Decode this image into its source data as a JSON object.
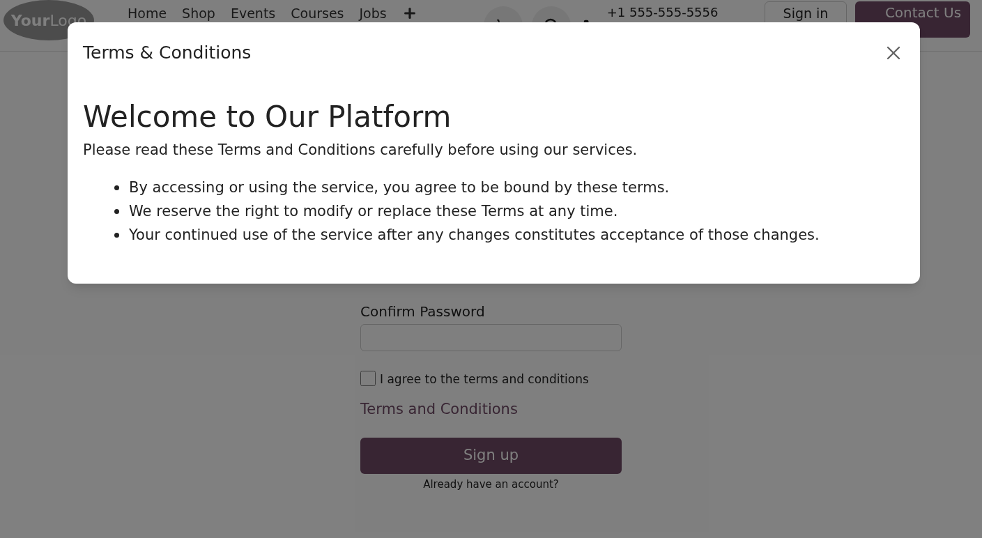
{
  "header": {
    "logo": "**Your**Logo",
    "nav": [
      {
        "label": "Home"
      },
      {
        "label": "Shop"
      },
      {
        "label": "Events"
      },
      {
        "label": "Courses"
      },
      {
        "label": "Jobs"
      }
    ],
    "phone": "+1 555-555-5556",
    "sign_in": "Sign in",
    "contact": "Contact Us"
  },
  "form": {
    "confirm_label": "Confirm Password",
    "agree": {
      "label": "I agree to the terms and conditions",
      "checked": false
    },
    "terms_link": "Terms and Conditions",
    "submit": "Sign up",
    "login_link": "Already have an account?"
  },
  "modal": {
    "title": "Terms & Conditions",
    "heading": "Welcome to Our Platform",
    "intro": "Please read these Terms and Conditions carefully before using our services.",
    "items": [
      "By accessing or using the service, you agree to be bound by these terms.",
      "We reserve the right to modify or replace these Terms at any time.",
      "Your continued use of the service after any changes constitutes acceptance of those changes."
    ]
  }
}
